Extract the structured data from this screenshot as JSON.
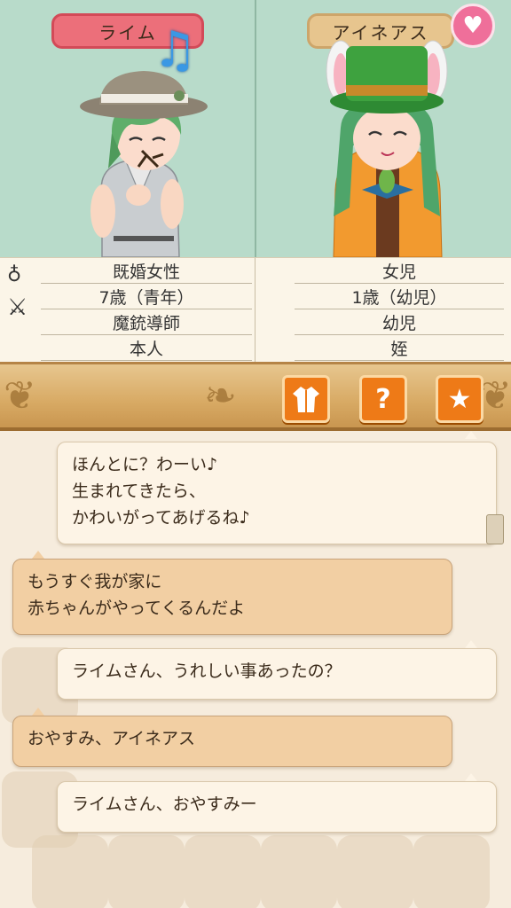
{
  "characters": {
    "left": {
      "name": "ライム",
      "gender_status": "既婚女性",
      "age": "7歳（青年）",
      "job": "魔銃導師",
      "relation": "本人"
    },
    "right": {
      "name": "アイネアス",
      "gender_status": "女児",
      "age": "1歳（幼児）",
      "job": "幼児",
      "relation": "姪"
    }
  },
  "icons": {
    "heart": "♥",
    "note": "♫",
    "ring": "♁",
    "swords": "⚔",
    "outfit": "👘",
    "help": "?",
    "favorite": "★"
  },
  "messages": [
    {
      "side": "right",
      "lines": [
        "ほんとに？わーい♪",
        "生まれてきたら、",
        "かわいがってあげるね♪"
      ]
    },
    {
      "side": "left",
      "lines": [
        "もうすぐ我が家に",
        "赤ちゃんがやってくるんだよ"
      ]
    },
    {
      "side": "right",
      "lines": [
        "ライムさん、うれしい事あったの？"
      ]
    },
    {
      "side": "left",
      "lines": [
        "おやすみ、アイネアス"
      ]
    },
    {
      "side": "right",
      "lines": [
        "ライムさん、おやすみー"
      ]
    }
  ],
  "colors": {
    "panel_bg": "#b8dbca",
    "left_tag": "#ec6f7a",
    "right_tag": "#e7c58e",
    "button_orange": "#ee7a17",
    "heart_pink": "#ef6f9a"
  }
}
